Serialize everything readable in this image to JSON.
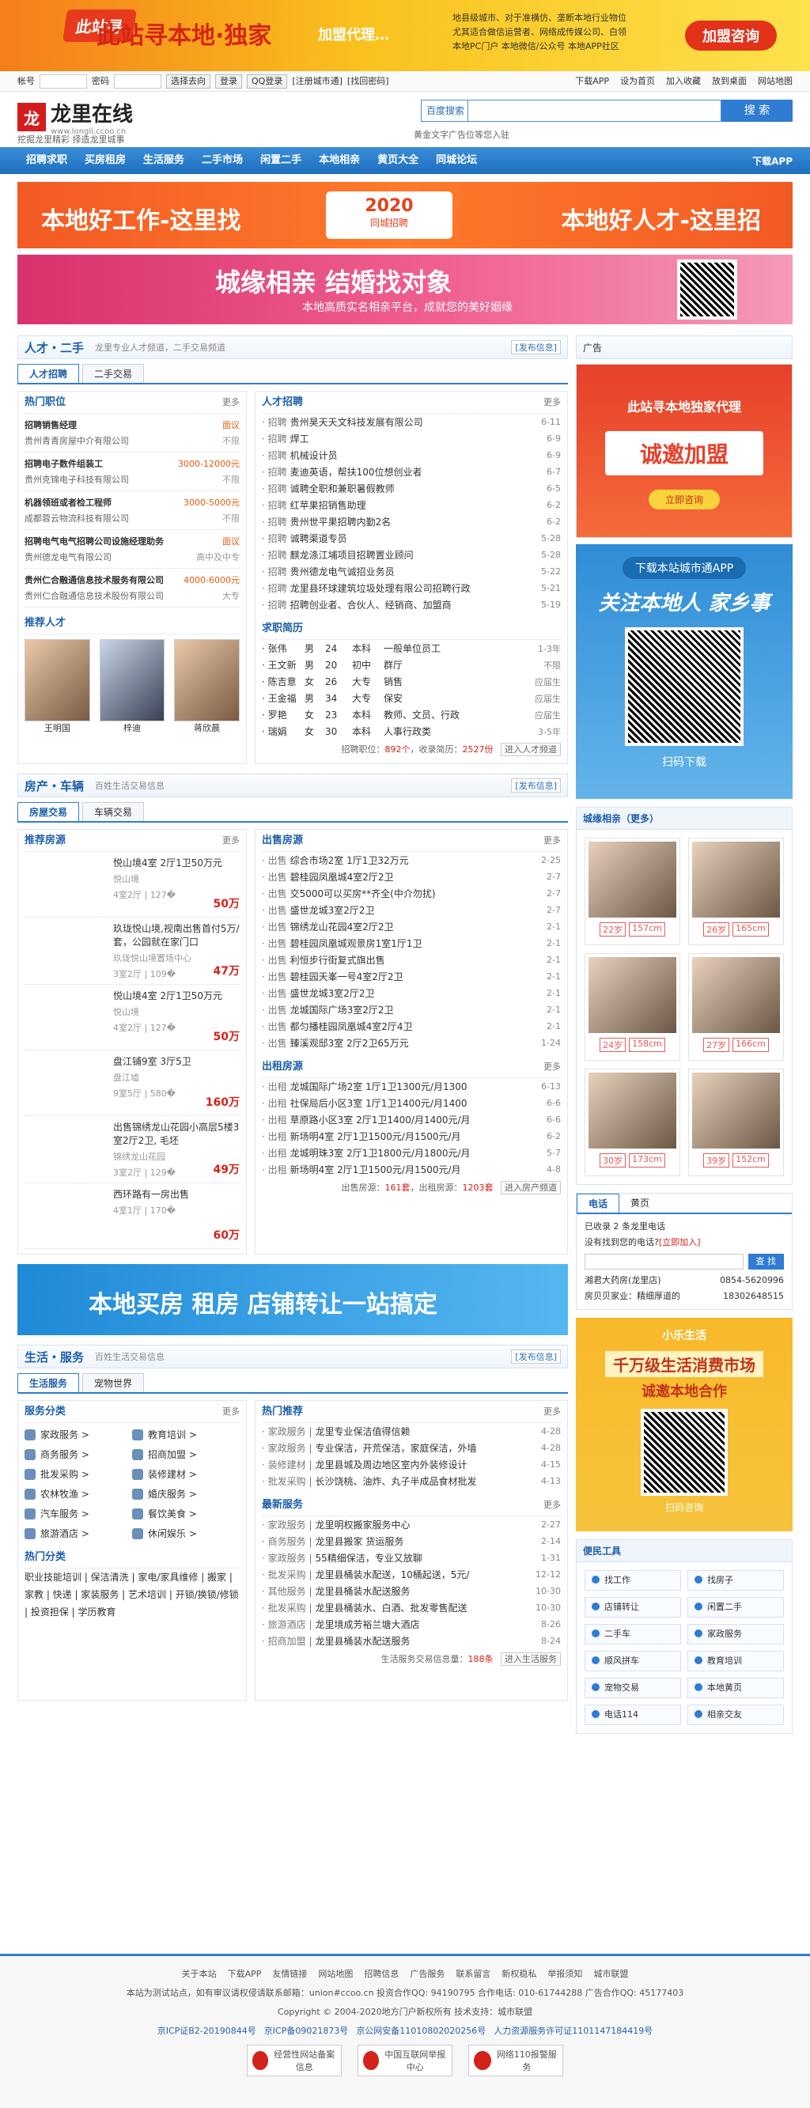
{
  "top_banner": {
    "logo_text": "此站寻本地·独家",
    "suffix": "加盟代理…",
    "list": [
      "地县级城市、对于准横仿、垄断本地行业物位",
      "尤其适合做信运营者、网络成传媒公司、白领",
      "本地PC门户  本地微信/公众号  本地APP社区"
    ],
    "button": "加盟咨询"
  },
  "loginbar": {
    "account_label": "帐号",
    "password_label": "密码",
    "method": "选择去向",
    "login": "登录",
    "qq_login": "QQ登录",
    "register": "[注册城市通]",
    "retrieve": "[找回密码]",
    "right": [
      "下载APP",
      "设为首页",
      "加入收藏",
      "放到桌面",
      "网站地图"
    ]
  },
  "header": {
    "logo_mark": "龙",
    "logo_cn": "龙里在线",
    "logo_url": "www.longli.ccoo.cn",
    "slogan": "挖掘龙里精彩 择造龙里城事",
    "search_select": "百度搜索",
    "search_btn": "搜 索",
    "search_tip": "黄金文字广告位等您入驻"
  },
  "nav": {
    "items": [
      "招聘求职",
      "买房租房",
      "生活服务",
      "二手市场",
      "闲置二手",
      "本地相亲",
      "黄页大全",
      "同城论坛"
    ],
    "right": "下载APP"
  },
  "banner1": {
    "left": "本地好工作-这里找",
    "mid_year": "2020",
    "mid_sub": "同城招聘",
    "right": "本地好人才-这里招"
  },
  "banner2": {
    "title": "城缘相亲 结婚找对象",
    "sub": "本地高质实名相亲平台，成就您的美好姻缘"
  },
  "talent": {
    "title": "人才・二手",
    "desc": "龙里专业人才频道，二手交易频道",
    "publish": "[发布信息]",
    "tabs": [
      "人才招聘",
      "二手交易"
    ],
    "hot_title": "热门职位",
    "more": "更多",
    "hot": [
      {
        "t": "招聘销售经理",
        "s": "面议",
        "c": "贵州青青房屋中介有限公司",
        "e": "不限"
      },
      {
        "t": "招聘电子数件组装工",
        "s": "3000-12000元",
        "c": "贵州克锦电子科技有限公司",
        "e": "不限"
      },
      {
        "t": "机器领班或者检工程师",
        "s": "3000-5000元",
        "c": "成都蓉云物流科技有限公司",
        "e": "不限"
      },
      {
        "t": "招聘电气电气招聘公司设施经理助务",
        "s": "面议",
        "c": "贵州德龙电气有限公司",
        "e": "高中及中专"
      },
      {
        "t": "贵州仁合融通信息技术服务有限公司",
        "s": "4000-6000元",
        "c": "贵州仁合融通信息技术股份有限公司",
        "e": "大专"
      }
    ],
    "rec_title": "推荐人才",
    "people": [
      "王明国",
      "梓迪",
      "蒋欣晨"
    ],
    "job_title": "人才招聘",
    "jobs": [
      {
        "tag": "招聘",
        "t": "贵州昊天天文科技发展有限公司",
        "d": "6-11"
      },
      {
        "tag": "招聘",
        "t": "焊工",
        "d": "6-9"
      },
      {
        "tag": "招聘",
        "t": "机械设计员",
        "d": "6-9"
      },
      {
        "tag": "招聘",
        "t": "麦迪英语，帮扶100位想创业者",
        "d": "6-7"
      },
      {
        "tag": "招聘",
        "t": "诚聘全职和兼职暑假教师",
        "d": "6-5"
      },
      {
        "tag": "招聘",
        "t": "红苹果招销售助理",
        "d": "6-2"
      },
      {
        "tag": "招聘",
        "t": "贵州世平果招聘内勤2名",
        "d": "6-2"
      },
      {
        "tag": "招聘",
        "t": "诚聘渠道专员",
        "d": "5-28"
      },
      {
        "tag": "招聘",
        "t": "麒龙涤江埔项目招聘置业顾问",
        "d": "5-28"
      },
      {
        "tag": "招聘",
        "t": "贵州德龙电气诚招业务员",
        "d": "5-22"
      },
      {
        "tag": "招聘",
        "t": "龙里县环球建筑垃圾处理有限公司招聘行政",
        "d": "5-21"
      },
      {
        "tag": "招聘",
        "t": "招聘创业者、合伙人、经销商、加盟商",
        "d": "5-19"
      }
    ],
    "resume_title": "求职简历",
    "resumes": [
      [
        "张伟",
        "男",
        "24",
        "本科",
        "一般单位员工",
        "1-3年"
      ],
      [
        "王文新",
        "男",
        "20",
        "初中",
        "群厅",
        "不限"
      ],
      [
        "陈吉意",
        "女",
        "26",
        "大专",
        "销售",
        "应届生"
      ],
      [
        "王金福",
        "男",
        "34",
        "大专",
        "保安",
        "应届生"
      ],
      [
        "罗艳",
        "女",
        "23",
        "本科",
        "教师、文员、行政",
        "应届生"
      ],
      [
        "瑞娟",
        "女",
        "30",
        "本科",
        "人事行政类",
        "3-5年"
      ]
    ],
    "stat_prefix": "招聘职位：",
    "stat_job": "892个",
    "stat_mid": "，收录简历：",
    "stat_res": "2527份",
    "enter": "进入人才频道"
  },
  "house": {
    "title": "房产・车辆",
    "desc": "百姓生活交易信息",
    "publish": "[发布信息]",
    "tabs": [
      "房屋交易",
      "车辆交易"
    ],
    "rec_title": "推荐房源",
    "more": "更多",
    "rec": [
      {
        "t": "悦山境4室 2厅1卫50万元",
        "sub": "悦山境",
        "spec": "4室2厅 | 127�",
        "p": "50万"
      },
      {
        "t": "玖珑悦山境,视南出售首付5万/套，公园就在家门口",
        "sub": "玖珑悦山境置场中心",
        "spec": "3室2厅 | 109�",
        "p": "47万"
      },
      {
        "t": "悦山境4室 2厅1卫50万元",
        "sub": "悦山境",
        "spec": "4室2厅 | 127�",
        "p": "50万"
      },
      {
        "t": "盘江铺9室 3厅5卫",
        "sub": "盘江墟",
        "spec": "9室5厅 | 580�",
        "p": "160万"
      },
      {
        "t": "出售锦绣龙山花园小高层5楼3室2厅2卫, 毛坯",
        "sub": "锦绣龙山花园",
        "spec": "3室2厅 | 129�",
        "p": "49万"
      },
      {
        "t": "西环路有一房出售",
        "sub": "",
        "spec": "4室1厅 | 170�",
        "p": "60万"
      }
    ],
    "sale_title": "出售房源",
    "sales": [
      {
        "tag": "出售",
        "t": "综合市场2室 1厅1卫32万元",
        "d": "2-25"
      },
      {
        "tag": "出售",
        "t": "碧桂园凤凰城4室2厅2卫",
        "d": "2-7"
      },
      {
        "tag": "出售",
        "t": "交5000可以买房**齐全(中介勿扰)",
        "d": "2-7"
      },
      {
        "tag": "出售",
        "t": "盛世龙城3室2厅2卫",
        "d": "2-7"
      },
      {
        "tag": "出售",
        "t": "锦绣龙山花园4室2厅2卫",
        "d": "2-1"
      },
      {
        "tag": "出售",
        "t": "碧桂园凤凰城观景房1室1厅1卫",
        "d": "2-1"
      },
      {
        "tag": "出售",
        "t": "利恒步行街复式旗出售",
        "d": "2-1"
      },
      {
        "tag": "出售",
        "t": "碧桂园天峯一号4室2厅2卫",
        "d": "2-1"
      },
      {
        "tag": "出售",
        "t": "盛世龙城3室2厅2卫",
        "d": "2-1"
      },
      {
        "tag": "出售",
        "t": "龙城国际广场3室2厅2卫",
        "d": "2-1"
      },
      {
        "tag": "出售",
        "t": "都匀播桂园凤凰城4室2厅4卫",
        "d": "2-1"
      },
      {
        "tag": "出售",
        "t": "臻溪观邸3室 2厅2卫65万元",
        "d": "1-24"
      }
    ],
    "rent_title": "出租房源",
    "rents": [
      {
        "tag": "出租",
        "t": "龙城国际广场2室 1厅1卫1300元/月1300",
        "d": "6-13"
      },
      {
        "tag": "出租",
        "t": "社保局后小区3室 1厅1卫1400元/月1400",
        "d": "6-6"
      },
      {
        "tag": "出租",
        "t": "草原路小区3室 2厅1卫1400/月1400元/月",
        "d": "6-6"
      },
      {
        "tag": "出租",
        "t": "新场明4室 2厅1卫1500元/月1500元/月",
        "d": "6-2"
      },
      {
        "tag": "出租",
        "t": "龙城明珠3室 2厅1卫1800元/月1800元/月",
        "d": "5-7"
      },
      {
        "tag": "出租",
        "t": "新场明4室 2厅1卫1500元/月1500元/月",
        "d": "4-8"
      }
    ],
    "stat_prefix": "出售房源：",
    "stat_sale": "161套",
    "stat_mid": "，出租房源：",
    "stat_rent": "1203套",
    "enter": "进入房产频道"
  },
  "adbuy": {
    "text": "本地买房 租房 店铺转让一站搞定"
  },
  "life": {
    "title": "生活・服务",
    "desc": "百姓生活交易信息",
    "publish": "[发布信息]",
    "tabs": [
      "生活服务",
      "宠物世界"
    ],
    "cat_title": "服务分类",
    "more": "更多",
    "cats": [
      "家政服务",
      "教育培训",
      "商务服务",
      "招商加盟",
      "批发采购",
      "装修建材",
      "农林牧渔",
      "婚庆服务",
      "汽车服务",
      "餐饮美食",
      "旅游酒店",
      "休闲娱乐"
    ],
    "hot_cat_title": "热门分类",
    "hot_cats": "职业技能培训 | 保洁清洗 | 家电/家具维修 | 搬家 | 家教 | 快递 | 家装服务 | 艺术培训 | 开锁/换锁/修锁 | 投资担保 | 学历教育",
    "hot_title": "热门推荐",
    "hots": [
      {
        "tag": "家政服务",
        "t": "龙里专业保洁值得信赖",
        "d": "4-28"
      },
      {
        "tag": "家政服务",
        "t": "专业保洁，开荒保洁，家庭保洁，外墙",
        "d": "4-28"
      },
      {
        "tag": "装修建材",
        "t": "龙里县城及周边地区室内外装修设计",
        "d": "4-15"
      },
      {
        "tag": "批发采购",
        "t": "长沙饶桃、油炸、丸子半成品食材批发",
        "d": "4-13"
      }
    ],
    "new_title": "最新服务",
    "news": [
      {
        "tag": "家政服务",
        "t": "龙里明权搬家服务中心",
        "d": "2-27"
      },
      {
        "tag": "商务服务",
        "t": "龙里县搬家 货运服务",
        "d": "2-14"
      },
      {
        "tag": "家政服务",
        "t": "55精细保洁，专业又放聊",
        "d": "1-31"
      },
      {
        "tag": "批发采购",
        "t": "龙里县桶装水配送，10桶起送，5元/",
        "d": "12-12"
      },
      {
        "tag": "其他服务",
        "t": "龙里县桶装水配送服务",
        "d": "10-30"
      },
      {
        "tag": "批发采购",
        "t": "龙里县桶装水、白酒、批发零售配送",
        "d": "10-30"
      },
      {
        "tag": "旅游酒店",
        "t": "龙里境成芳裕兰塘大酒店",
        "d": "8-26"
      },
      {
        "tag": "招商加盟",
        "t": "龙里县桶装水配送服务",
        "d": "8-24"
      }
    ],
    "stat_prefix": "生活服务交易信息量：",
    "stat": "188条",
    "enter": "进入生活服务"
  },
  "right": {
    "ad_label": "广告",
    "ad1": {
      "t": "此站寻本地独家代理",
      "big": "诚邀加盟",
      "btn": "立即咨询"
    },
    "ad2": {
      "top": "下载本站城市通APP",
      "big": "关注本地人 家乡事",
      "txt": "扫码下载"
    },
    "mate_title": "城缘相亲（更多）",
    "mates": [
      {
        "age": "22岁",
        "h": "157cm"
      },
      {
        "age": "26岁",
        "h": "165cm"
      },
      {
        "age": "24岁",
        "h": "158cm"
      },
      {
        "age": "27岁",
        "h": "166cm"
      },
      {
        "age": "30岁",
        "h": "173cm"
      },
      {
        "age": "39岁",
        "h": "152cm"
      }
    ],
    "phone_tabs": [
      "电话",
      "黄页"
    ],
    "phone_count": "已收录 2 条龙里电话",
    "phone_miss": "没有找到您的电话?",
    "phone_add": "[立即加入]",
    "phone_btn": "查 找",
    "phones": [
      [
        "湘君大药房(龙里店)",
        "0854-5620996"
      ],
      [
        "房贝贝家业：精细厚道的",
        "18302648515"
      ]
    ],
    "ad3": {
      "brand": "小乐生活",
      "s2": "千万级生活消费市场",
      "s3": "诚邀本地合作",
      "txt": "扫码咨询"
    },
    "tools_title": "便民工具",
    "tools": [
      "找工作",
      "找房子",
      "店铺转让",
      "闲置二手",
      "二手车",
      "家政服务",
      "顺风拼车",
      "教育培训",
      "宠物交易",
      "本地黄页",
      "电话114",
      "相亲交友"
    ]
  },
  "footer": {
    "links": [
      "关于本站",
      "下载APP",
      "友情链接",
      "网站地图",
      "招聘信息",
      "广告服务",
      "联系留言",
      "新权稳私",
      "举报须知",
      "城市联盟"
    ],
    "line1": "本站为测试站点，如有审议请权侵请联系邮箱：union#ccoo.cn   投资合作QQ: 94190795   合作电话: 010-61744288   广告合作QQ: 45177403",
    "line2": "Copyright © 2004-2020地方门户新权所有   技术支持：城市联盟",
    "icp": [
      "京ICP证B2-20190844号",
      "京ICP备09021873号",
      "京公网安备11010802020256号",
      "人力资源服务许可证1101147184419号"
    ],
    "badges": [
      "经营性网站备案信息",
      "中国互联网举报中心",
      "网络110报警服务"
    ]
  }
}
